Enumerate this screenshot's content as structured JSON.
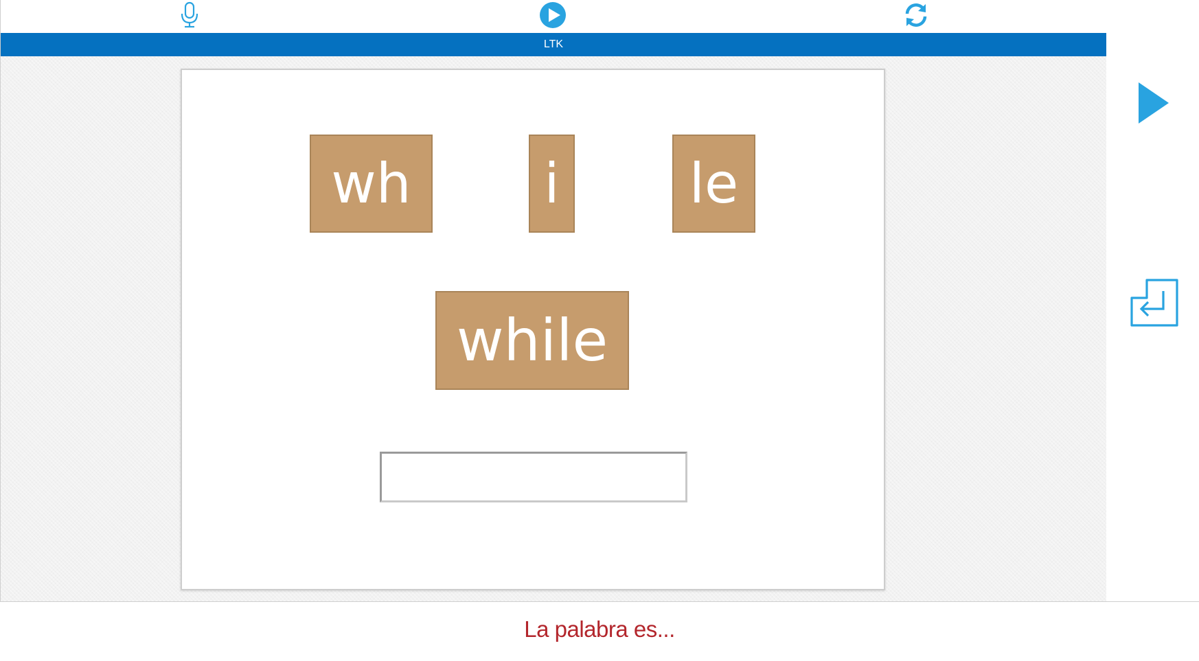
{
  "toolbar": {
    "mic_icon": "microphone-icon",
    "play_icon": "play-circle-icon",
    "refresh_icon": "refresh-icon"
  },
  "title_bar": {
    "label": "LTK"
  },
  "card": {
    "syllables": [
      "wh",
      "i",
      "le"
    ],
    "word": "while",
    "answer": {
      "value": "",
      "placeholder": ""
    }
  },
  "side": {
    "next_icon": "play-triangle-icon",
    "enter_icon": "enter-return-icon"
  },
  "prompt": {
    "text": "La palabra es..."
  },
  "colors": {
    "accent_blue": "#0571c0",
    "icon_blue": "#29a3e0",
    "tile_tan": "#c69c6d",
    "prompt_red": "#b3262c"
  }
}
